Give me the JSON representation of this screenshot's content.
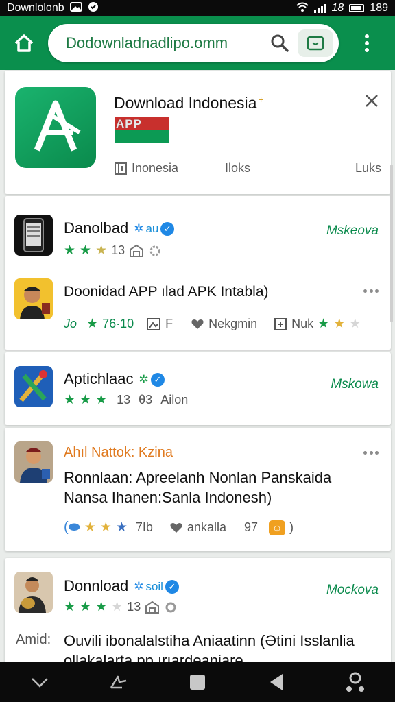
{
  "status_bar": {
    "left_text": "Downlolonb",
    "time": "189",
    "signal_label": "18"
  },
  "toolbar": {
    "url": "Dodownladnadlipo.omm"
  },
  "featured": {
    "title": "Download Indonesia",
    "spark": "+",
    "flag_text": "APP",
    "tabs": [
      "Inonesia",
      "Iloks",
      "Luks"
    ]
  },
  "rows": [
    {
      "title": "Danolbad",
      "verify": "au",
      "action": "Mskeova",
      "rating": "13"
    },
    {
      "title": "Doonidad APP ılad APK Intabla)",
      "m1": "Jo",
      "m2": "76·10",
      "m3": "F",
      "m4": "Nekgmin",
      "m5": "Nuk"
    },
    {
      "title": "Aptichlaac",
      "verify": "",
      "action": "Mskowa",
      "rating": "13",
      "extra": "Ailon",
      "extra_code": "θ3"
    },
    {
      "title": "Ahıl Nattok: Kzina",
      "body": "Ronnlaan: Apreelanh Nonlan Panskaida Nansa Ihanen:Sanla Indonesh)",
      "m1": "7Ib",
      "m2": "ankalla",
      "m3": "97"
    },
    {
      "title": "Donnload",
      "verify": "soil",
      "action": "Mockova",
      "rating": "13",
      "label": "Amid:",
      "body": "Ouvili ibonalalstiha Aniaatinn (Ətini Isslanlia ollakalarta pp ırıardeaniare"
    }
  ],
  "colors": {
    "brand_green": "#0a8f4d",
    "accent_blue": "#1f88e5",
    "orange": "#e07a1f"
  },
  "icons": [
    "home-icon",
    "search-icon",
    "tab-switcher-icon",
    "overflow-menu-icon",
    "close-icon",
    "verified-icon",
    "star-icon",
    "heart-icon",
    "more-icon",
    "back-icon",
    "recents-icon",
    "nav-home-icon"
  ]
}
